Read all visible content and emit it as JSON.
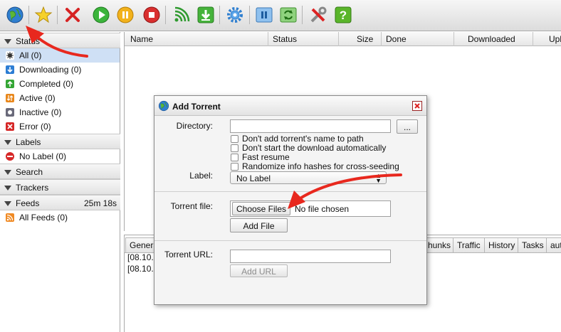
{
  "toolbar": {
    "buttons": [
      {
        "name": "add-torrent",
        "icon": "globe-icon"
      },
      {
        "name": "add-feed",
        "icon": "star-icon"
      },
      {
        "name": "remove",
        "icon": "red-x-icon"
      },
      {
        "name": "start",
        "icon": "play-icon"
      },
      {
        "name": "pause",
        "icon": "pause-icon"
      },
      {
        "name": "stop",
        "icon": "stop-icon"
      },
      {
        "name": "rss",
        "icon": "rss-icon"
      },
      {
        "name": "download",
        "icon": "download-icon"
      },
      {
        "name": "settings",
        "icon": "gear-icon"
      },
      {
        "name": "pause-all",
        "icon": "pause-all-icon"
      },
      {
        "name": "refresh",
        "icon": "refresh-icon"
      },
      {
        "name": "tools",
        "icon": "tools-icon"
      },
      {
        "name": "help",
        "icon": "help-icon"
      }
    ]
  },
  "sidebar": {
    "status_section": "Status",
    "status_items": [
      {
        "label": "All (0)",
        "icon": "all-icon",
        "selected": true
      },
      {
        "label": "Downloading (0)",
        "icon": "downloading-icon"
      },
      {
        "label": "Completed (0)",
        "icon": "completed-icon"
      },
      {
        "label": "Active (0)",
        "icon": "active-icon"
      },
      {
        "label": "Inactive (0)",
        "icon": "inactive-icon"
      },
      {
        "label": "Error (0)",
        "icon": "error-icon"
      }
    ],
    "labels_section": "Labels",
    "labels_items": [
      {
        "label": "No Label (0)",
        "icon": "no-label-icon"
      }
    ],
    "search_section": "Search",
    "trackers_section": "Trackers",
    "feeds_section": "Feeds",
    "feeds_timer": "25m 18s",
    "feeds_items": [
      {
        "label": "All Feeds (0)",
        "icon": "rss-feed-icon"
      }
    ]
  },
  "list": {
    "columns": [
      "Name",
      "Status",
      "Size",
      "Done",
      "Downloaded",
      "Upl"
    ]
  },
  "bottom": {
    "tabs": [
      "Genera",
      "hunks",
      "Traffic",
      "History",
      "Tasks",
      "aut"
    ],
    "log_lines": [
      "[08.10.2",
      "[08.10.2"
    ]
  },
  "dialog": {
    "title": "Add Torrent",
    "directory_label": "Directory:",
    "directory_value": "",
    "browse_label": "...",
    "checkboxes": [
      "Don't add torrent's name to path",
      "Don't start the download automatically",
      "Fast resume",
      "Randomize info hashes for cross-seeding"
    ],
    "label_label": "Label:",
    "label_value": "No Label",
    "torrent_file_label": "Torrent file:",
    "choose_files_label": "Choose Files",
    "no_file_text": "No file chosen",
    "add_file_label": "Add File",
    "torrent_url_label": "Torrent URL:",
    "torrent_url_value": "",
    "add_url_label": "Add URL"
  },
  "colors": {
    "arrow": "#e8281e",
    "selection": "#cfe0f5",
    "help_green": "#5ab52a"
  }
}
